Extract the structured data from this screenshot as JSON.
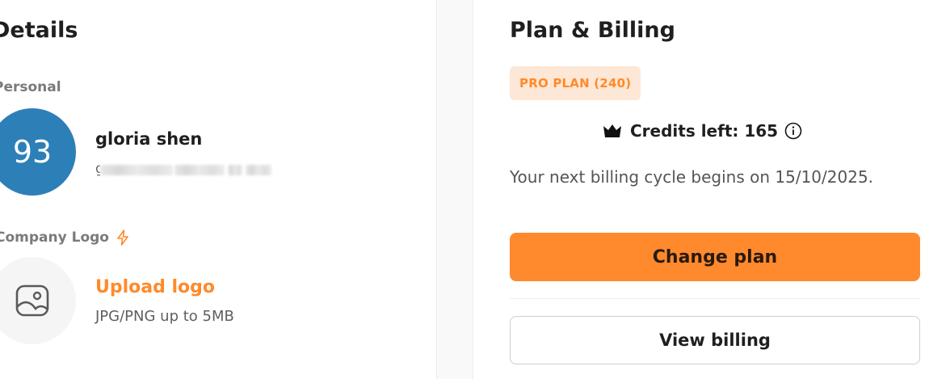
{
  "details": {
    "title": "Details",
    "personal_label": "Personal",
    "avatar_text": "93",
    "user_name": "gloria shen",
    "user_email_visible": "g",
    "company_logo_label": "Company Logo",
    "upload_logo_label": "Upload logo",
    "upload_hint": "JPG/PNG up to 5MB"
  },
  "billing": {
    "title": "Plan & Billing",
    "plan_badge": "PRO PLAN (240)",
    "credits_text": "Credits left: 165",
    "billing_cycle_text": "Your next billing cycle begins on 15/10/2025.",
    "change_plan_label": "Change plan",
    "view_billing_label": "View billing"
  },
  "icons": {
    "spark": "spark-icon",
    "image": "image-icon",
    "crown": "crown-icon",
    "info": "info-icon"
  },
  "colors": {
    "accent": "#ff8a2e",
    "badge_bg": "#fde7d6",
    "avatar_bg": "#2d7fb8"
  }
}
